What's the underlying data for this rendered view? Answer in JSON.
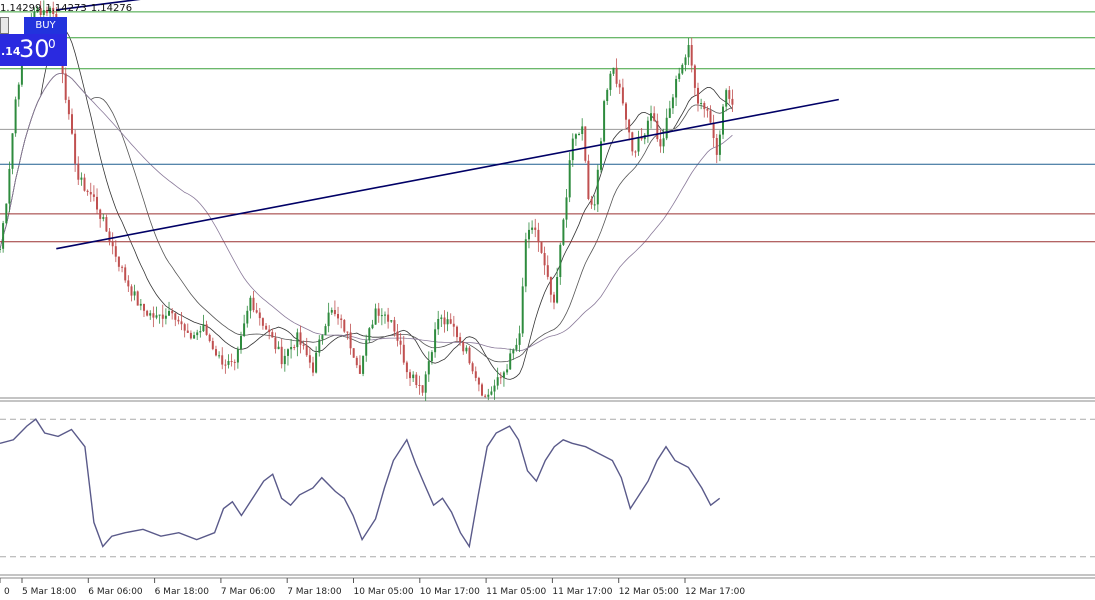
{
  "quote": [
    "1.14299",
    "1.14273",
    "1.14276"
  ],
  "trade_panel": {
    "buy_label": "BUY",
    "price_prefix": ".14",
    "price_big": "30",
    "price_super": "0"
  },
  "colors": {
    "bull": "#2e8b3e",
    "bear": "#c05050",
    "ma_fast": "#333333",
    "ma_mid": "#555555",
    "ma_slow": "#8a7a9a",
    "rsi": "#5a5a8a",
    "support_green": "#3aa03a",
    "blue_line": "#1f5f8f",
    "red_line": "#9a3030",
    "gray_line": "#999999",
    "trendline": "#000066"
  },
  "chart_data": {
    "type": "candlestick",
    "x_tick_labels": [
      "5 Mar 18:00",
      "6 Mar 06:00",
      "6 Mar 18:00",
      "7 Mar 06:00",
      "7 Mar 18:00",
      "10 Mar 05:00",
      "10 Mar 17:00",
      "11 Mar 05:00",
      "11 Mar 17:00",
      "12 Mar 05:00",
      "12 Mar 17:00"
    ],
    "first_tick_fragment": "0",
    "ylim": [
      1.139,
      1.143
    ],
    "bars": 200,
    "x_tick_bar_index": [
      12,
      37,
      62,
      86,
      111,
      135,
      160,
      185,
      210,
      235,
      260
    ],
    "price_path": [
      [
        0,
        1.1405
      ],
      [
        2,
        1.141
      ],
      [
        5,
        1.142
      ],
      [
        8,
        1.1426
      ],
      [
        10,
        1.1428
      ],
      [
        12,
        1.1429
      ],
      [
        17,
        1.1429
      ],
      [
        20,
        1.1423
      ],
      [
        22,
        1.1418
      ],
      [
        25,
        1.1412
      ],
      [
        30,
        1.141
      ],
      [
        35,
        1.1406
      ],
      [
        40,
        1.1402
      ],
      [
        45,
        1.1399
      ],
      [
        50,
        1.1398
      ],
      [
        55,
        1.1399
      ],
      [
        60,
        1.1396
      ],
      [
        65,
        1.1397
      ],
      [
        70,
        1.1394
      ],
      [
        75,
        1.1393
      ],
      [
        80,
        1.14
      ],
      [
        85,
        1.1397
      ],
      [
        90,
        1.1394
      ],
      [
        95,
        1.1396
      ],
      [
        100,
        1.1393
      ],
      [
        105,
        1.1399
      ],
      [
        110,
        1.1397
      ],
      [
        115,
        1.1393
      ],
      [
        120,
        1.1399
      ],
      [
        125,
        1.1398
      ],
      [
        130,
        1.1393
      ],
      [
        135,
        1.1391
      ],
      [
        140,
        1.1398
      ],
      [
        145,
        1.1397
      ],
      [
        150,
        1.1394
      ],
      [
        155,
        1.139
      ],
      [
        160,
        1.1392
      ],
      [
        163,
        1.1394
      ],
      [
        166,
        1.1396
      ],
      [
        168,
        1.1406
      ],
      [
        171,
        1.1407
      ],
      [
        174,
        1.1403
      ],
      [
        177,
        1.1399
      ],
      [
        180,
        1.1408
      ],
      [
        183,
        1.1416
      ],
      [
        186,
        1.1417
      ],
      [
        188,
        1.141
      ],
      [
        190,
        1.1409
      ],
      [
        193,
        1.142
      ],
      [
        196,
        1.1423
      ],
      [
        199,
        1.142
      ],
      [
        202,
        1.1415
      ],
      [
        205,
        1.1416
      ],
      [
        208,
        1.1419
      ],
      [
        211,
        1.1415
      ],
      [
        214,
        1.1419
      ],
      [
        217,
        1.1423
      ],
      [
        220,
        1.1425
      ],
      [
        223,
        1.142
      ],
      [
        226,
        1.1419
      ],
      [
        229,
        1.1415
      ],
      [
        232,
        1.1421
      ],
      [
        234,
        1.1419
      ]
    ],
    "horizontal_levels": [
      {
        "price": 1.14288,
        "color": "support_green"
      },
      {
        "price": 1.14262,
        "color": "support_green"
      },
      {
        "price": 1.14231,
        "color": "support_green"
      },
      {
        "price": 1.1417,
        "color": "gray_line"
      },
      {
        "price": 1.14135,
        "color": "blue_line"
      },
      {
        "price": 1.14085,
        "color": "red_line"
      },
      {
        "price": 1.14057,
        "color": "red_line"
      }
    ],
    "trendlines": [
      {
        "from": [
          18,
          1.1429
        ],
        "to": [
          118,
          1.1433
        ]
      },
      {
        "from": [
          18,
          1.1405
        ],
        "to": [
          268,
          1.142
        ]
      }
    ],
    "rsi": {
      "ylim": [
        25,
        75
      ],
      "levels": [
        70,
        30
      ],
      "path": [
        [
          0,
          63
        ],
        [
          3,
          64
        ],
        [
          6,
          68
        ],
        [
          8,
          70
        ],
        [
          10,
          66
        ],
        [
          13,
          65
        ],
        [
          16,
          67
        ],
        [
          19,
          62
        ],
        [
          21,
          40
        ],
        [
          23,
          33
        ],
        [
          25,
          36
        ],
        [
          28,
          37
        ],
        [
          32,
          38
        ],
        [
          36,
          36
        ],
        [
          40,
          37
        ],
        [
          44,
          35
        ],
        [
          48,
          37
        ],
        [
          50,
          44
        ],
        [
          52,
          46
        ],
        [
          54,
          42
        ],
        [
          57,
          48
        ],
        [
          59,
          52
        ],
        [
          61,
          54
        ],
        [
          63,
          47
        ],
        [
          65,
          45
        ],
        [
          67,
          48
        ],
        [
          70,
          50
        ],
        [
          72,
          53
        ],
        [
          75,
          49
        ],
        [
          77,
          47
        ],
        [
          79,
          42
        ],
        [
          81,
          35
        ],
        [
          84,
          41
        ],
        [
          86,
          50
        ],
        [
          88,
          58
        ],
        [
          91,
          64
        ],
        [
          93,
          57
        ],
        [
          95,
          51
        ],
        [
          97,
          45
        ],
        [
          99,
          47
        ],
        [
          101,
          43
        ],
        [
          103,
          37
        ],
        [
          105,
          33
        ],
        [
          107,
          48
        ],
        [
          109,
          62
        ],
        [
          111,
          66
        ],
        [
          114,
          68
        ],
        [
          116,
          64
        ],
        [
          118,
          55
        ],
        [
          120,
          52
        ],
        [
          122,
          58
        ],
        [
          124,
          62
        ],
        [
          126,
          64
        ],
        [
          128,
          63
        ],
        [
          131,
          62
        ],
        [
          134,
          60
        ],
        [
          137,
          58
        ],
        [
          139,
          53
        ],
        [
          141,
          44
        ],
        [
          143,
          48
        ],
        [
          145,
          52
        ],
        [
          147,
          58
        ],
        [
          149,
          62
        ],
        [
          151,
          58
        ],
        [
          154,
          56
        ],
        [
          157,
          50
        ],
        [
          159,
          45
        ],
        [
          161,
          47
        ]
      ]
    }
  }
}
